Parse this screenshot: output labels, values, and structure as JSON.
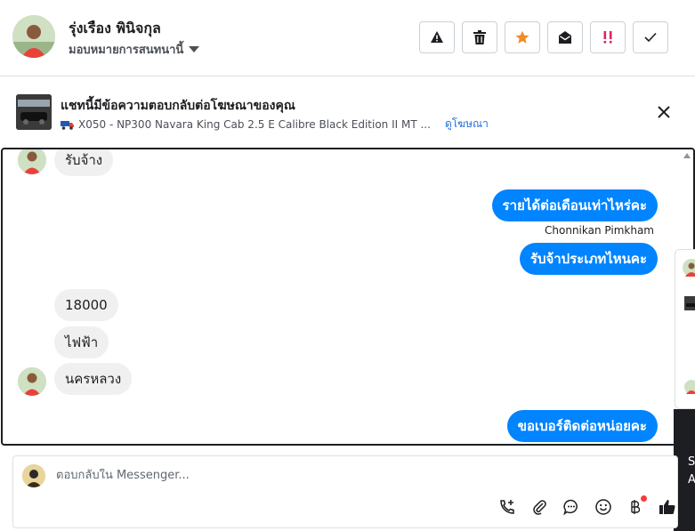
{
  "header": {
    "contact_name": "รุ่งเรือง พินิจกุล",
    "assign_label": "มอบหมายการสนทนานี้"
  },
  "ad_banner": {
    "title": "แชทนี้มีข้อความตอบกลับต่อโฆษณาของคุณ",
    "ad_name": "X050 - NP300 Navara King Cab 2.5 E Calibre Black Edition II MT ...",
    "view_ad_link": "ดูโฆษณา"
  },
  "messages": [
    {
      "direction": "in",
      "text": "รับจ้าง"
    },
    {
      "direction": "out",
      "text": "รายได้ต่อเดือนเท่าไหร่คะ",
      "sender": "Chonnikan Pimkham"
    },
    {
      "direction": "out",
      "text": "รับจ้าประเภทไหนคะ"
    },
    {
      "direction": "in",
      "text": "18000"
    },
    {
      "direction": "in",
      "text": "ไฟฟ้า"
    },
    {
      "direction": "in",
      "text": "นครหลวง"
    },
    {
      "direction": "out",
      "text": "ขอเบอร์ติดต่อหน่อยคะ"
    }
  ],
  "composer": {
    "placeholder": "ตอบกลับใน Messenger..."
  },
  "side_peek": {
    "line1": "S",
    "line2": "A"
  },
  "colors": {
    "outgoing_bubble": "#0084ff",
    "incoming_bubble": "#f0f0f0",
    "link": "#216fdb",
    "star": "#f28c28",
    "important": "#e0245e"
  }
}
